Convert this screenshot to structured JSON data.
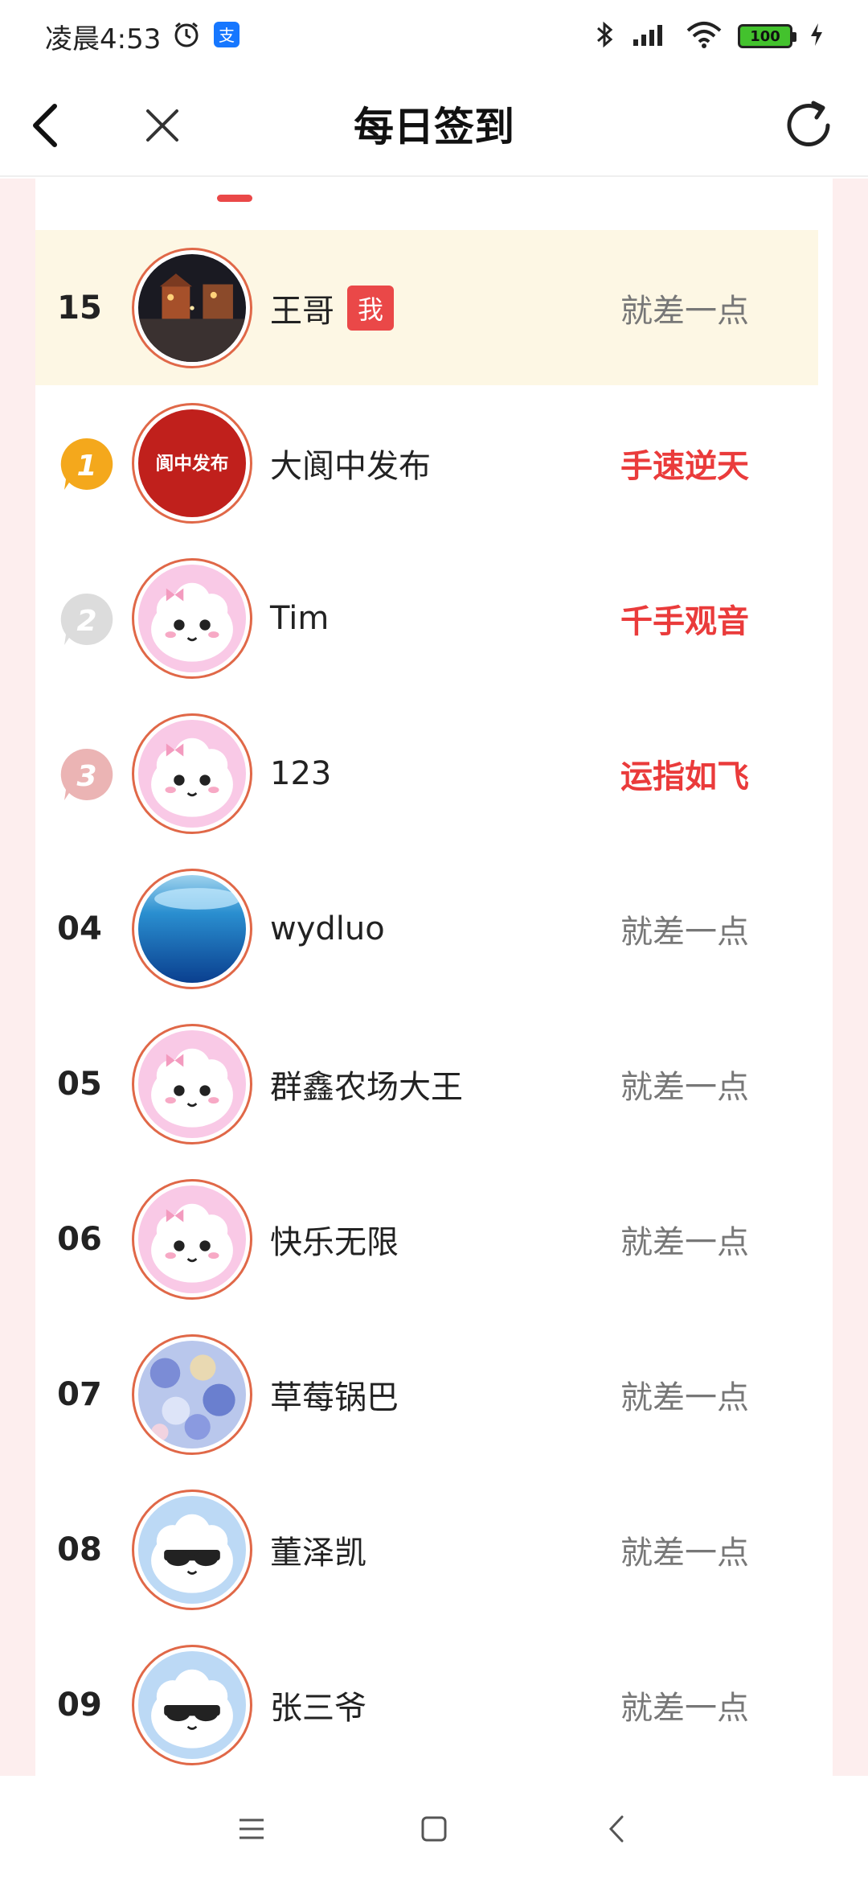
{
  "status_bar": {
    "time": "凌晨4:53",
    "battery": "100",
    "icons": [
      "alarm-icon",
      "alipay-icon",
      "bluetooth-icon",
      "signal-icon",
      "wifi-icon",
      "battery-icon",
      "charging-icon"
    ]
  },
  "header": {
    "title": "每日签到",
    "back_icon": "back-arrow-icon",
    "close_icon": "close-icon",
    "refresh_icon": "refresh-icon"
  },
  "colors": {
    "accent": "#ea4848",
    "highlight_row": "#fdf7e4",
    "page_bg": "#fdeeee",
    "gold": "#f4a81c",
    "silver": "#d3d3d3",
    "bronze": "#e9b0b0"
  },
  "my_rank": {
    "rank": "15",
    "name": "王哥",
    "badge": "我",
    "result": "就差一点",
    "avatar": "street-night-photo"
  },
  "ranking": [
    {
      "rank": "1",
      "medal": "gold-medal-icon",
      "name": "大阆中发布",
      "result": "手速逆天",
      "hot": true,
      "avatar": "logo",
      "avatar_text": "阆中发布"
    },
    {
      "rank": "2",
      "medal": "silver-medal-icon",
      "name": "Tim",
      "result": "千手观音",
      "hot": true,
      "avatar": "pink-cloud"
    },
    {
      "rank": "3",
      "medal": "bronze-medal-icon",
      "name": "123",
      "result": "运指如飞",
      "hot": true,
      "avatar": "pink-cloud"
    },
    {
      "rank": "04",
      "name": "wydluo",
      "result": "就差一点",
      "hot": false,
      "avatar": "sea"
    },
    {
      "rank": "05",
      "name": "群鑫农场大王",
      "result": "就差一点",
      "hot": false,
      "avatar": "pink-cloud"
    },
    {
      "rank": "06",
      "name": "快乐无限",
      "result": "就差一点",
      "hot": false,
      "avatar": "pink-cloud"
    },
    {
      "rank": "07",
      "name": "草莓锅巴",
      "result": "就差一点",
      "hot": false,
      "avatar": "blue-pattern"
    },
    {
      "rank": "08",
      "name": "董泽凯",
      "result": "就差一点",
      "hot": false,
      "avatar": "blue-cloud"
    },
    {
      "rank": "09",
      "name": "张三爷",
      "result": "就差一点",
      "hot": false,
      "avatar": "blue-cloud"
    }
  ],
  "nav": {
    "menu_icon": "menu-icon",
    "home_icon": "home-icon",
    "back_icon": "back-icon"
  }
}
